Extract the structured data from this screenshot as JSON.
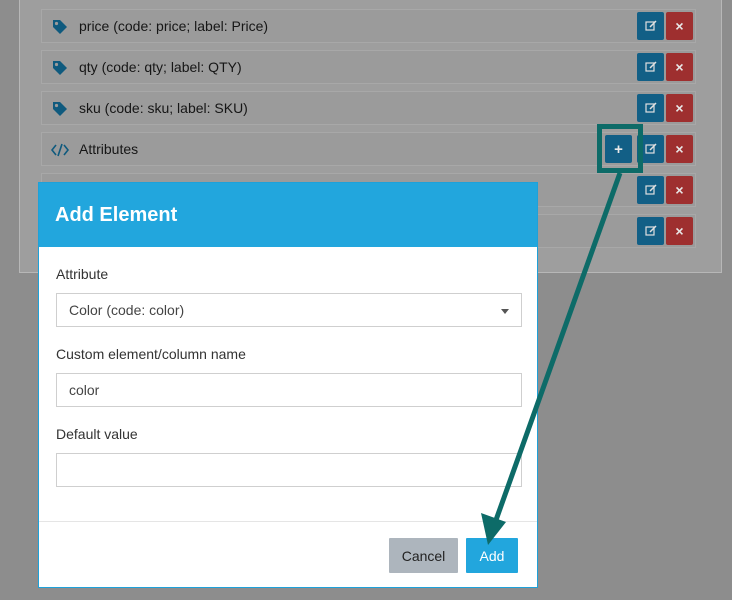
{
  "rows": [
    {
      "icon": "tag-icon",
      "label": "price (code: price; label: Price)"
    },
    {
      "icon": "tag-icon",
      "label": "qty (code: qty; label: QTY)"
    },
    {
      "icon": "tag-icon",
      "label": "sku (code: sku; label: SKU)"
    },
    {
      "icon": "code-icon",
      "label": "Attributes"
    }
  ],
  "row_buttons": {
    "add": "+",
    "delete": "×"
  },
  "modal": {
    "title": "Add Element",
    "attribute_label": "Attribute",
    "attribute_value": "Color (code: color)",
    "custom_name_label": "Custom element/column name",
    "custom_name_value": "color",
    "default_value_label": "Default value",
    "default_value_value": "",
    "cancel_label": "Cancel",
    "add_label": "Add"
  },
  "colors": {
    "accent": "#22a6dd",
    "annotation": "#0d6b68",
    "delete": "#9e2f2f",
    "edit": "#125f86"
  }
}
